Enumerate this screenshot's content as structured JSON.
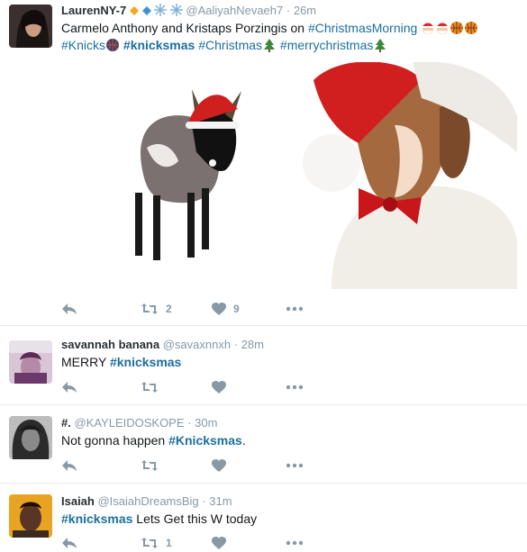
{
  "tweets": [
    {
      "name": "LaurenNY-7",
      "handle": "@AaliyahNevaeh7",
      "dot": "·",
      "time": "26m",
      "line1_pre": "Carmelo Anthony and Kristaps Porzingis on ",
      "line1_tag": "#ChristmasMorning",
      "line2_tag1": "#Knicks",
      "line2_tag2": "#knicksmas",
      "line2_tag3": "#Christmas",
      "line2_tag4": "#merrychristmas",
      "retweets": "2",
      "likes": "9"
    },
    {
      "name": "savannah banana",
      "handle": "@savaxnnxh",
      "dot": "·",
      "time": "28m",
      "text_pre": "MERRY ",
      "text_tag": "#knicksmas"
    },
    {
      "name": "#.",
      "handle": "@KAYLEIDOSKOPE",
      "dot": "·",
      "time": "30m",
      "text_pre": "Not gonna happen ",
      "text_tag": "#Knicksmas",
      "text_post": "."
    },
    {
      "name": "Isaiah",
      "handle": "@IsaiahDreamsBig",
      "dot": "·",
      "time": "31m",
      "text_tag": "#knicksmas",
      "text_post": " Lets Get this W today",
      "retweets": "1"
    }
  ],
  "icons": [
    "reply-icon",
    "retweet-icon",
    "like-icon",
    "more-icon",
    "christmas-tree-icon",
    "santa-icon",
    "basketball-icon",
    "snowflake-icon",
    "diamond-icon"
  ],
  "colors": {
    "link": "#1b6f9e",
    "muted": "#8899a6",
    "divider": "#e6ecf0",
    "orange_diamond": "#f5a623",
    "blue_diamond": "#3b94d9"
  }
}
